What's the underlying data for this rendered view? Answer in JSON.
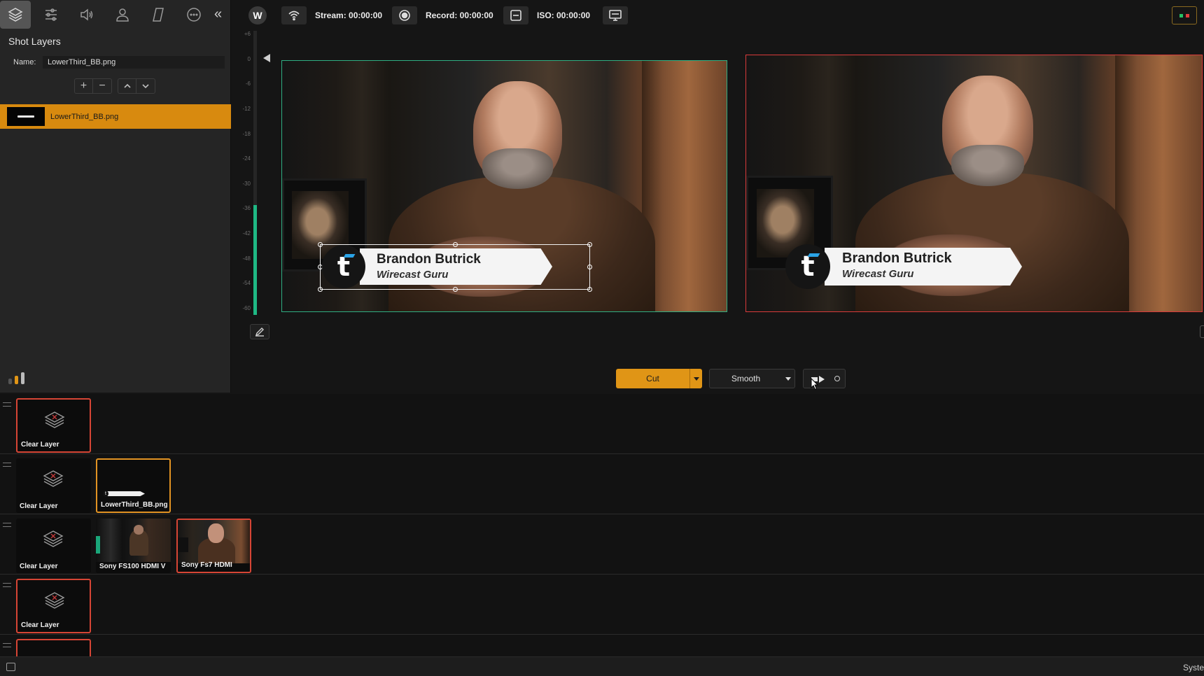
{
  "left_panel": {
    "toolbar_icons": [
      "layers-icon",
      "sliders-icon",
      "speaker-icon",
      "person-icon",
      "parallelogram-icon",
      "more-icon"
    ],
    "collapse_glyph": "«",
    "title": "Shot Layers",
    "name_label": "Name:",
    "name_value": "LowerThird_BB.png",
    "layer_controls": {
      "add": "+",
      "remove": "−"
    },
    "selected_layer": "LowerThird_BB.png"
  },
  "topbar": {
    "logo_glyph": "W",
    "stream_label": "Stream: 00:00:00",
    "record_label": "Record: 00:00:00",
    "iso_label": "ISO: 00:00:00",
    "status_colors": [
      "#27c063",
      "#e03c3c"
    ]
  },
  "audio_meter": {
    "ticks": [
      "+6",
      "0",
      "-6",
      "-12",
      "-18",
      "-24",
      "-30",
      "-36",
      "-42",
      "-48",
      "-54",
      "-60"
    ],
    "level_fraction": 0.39,
    "color": "#1fb884"
  },
  "preview": {
    "lower_third": {
      "name": "Brandon Butrick",
      "role": "Wirecast Guru",
      "logo": "t"
    },
    "border_color": "#2fae82"
  },
  "live": {
    "lower_third": {
      "name": "Brandon Butrick",
      "role": "Wirecast Guru",
      "logo": "t"
    },
    "border_color": "#d93b3b"
  },
  "transitions": {
    "cut_label": "Cut",
    "smooth_label": "Smooth",
    "accent": "#e09516"
  },
  "layers": [
    {
      "shots": [
        {
          "label": "Clear Layer",
          "state": "live"
        }
      ]
    },
    {
      "shots": [
        {
          "label": "Clear Layer",
          "state": "none"
        },
        {
          "label": "LowerThird_BB.png",
          "state": "preview"
        }
      ]
    },
    {
      "shots": [
        {
          "label": "Clear Layer",
          "state": "none"
        },
        {
          "label": "Sony FS100 HDMI V",
          "state": "none"
        },
        {
          "label": "Sony Fs7 HDMI",
          "state": "live"
        }
      ]
    },
    {
      "shots": [
        {
          "label": "Clear Layer",
          "state": "live"
        }
      ]
    }
  ],
  "statusbar": {
    "right_text": "Syste"
  }
}
